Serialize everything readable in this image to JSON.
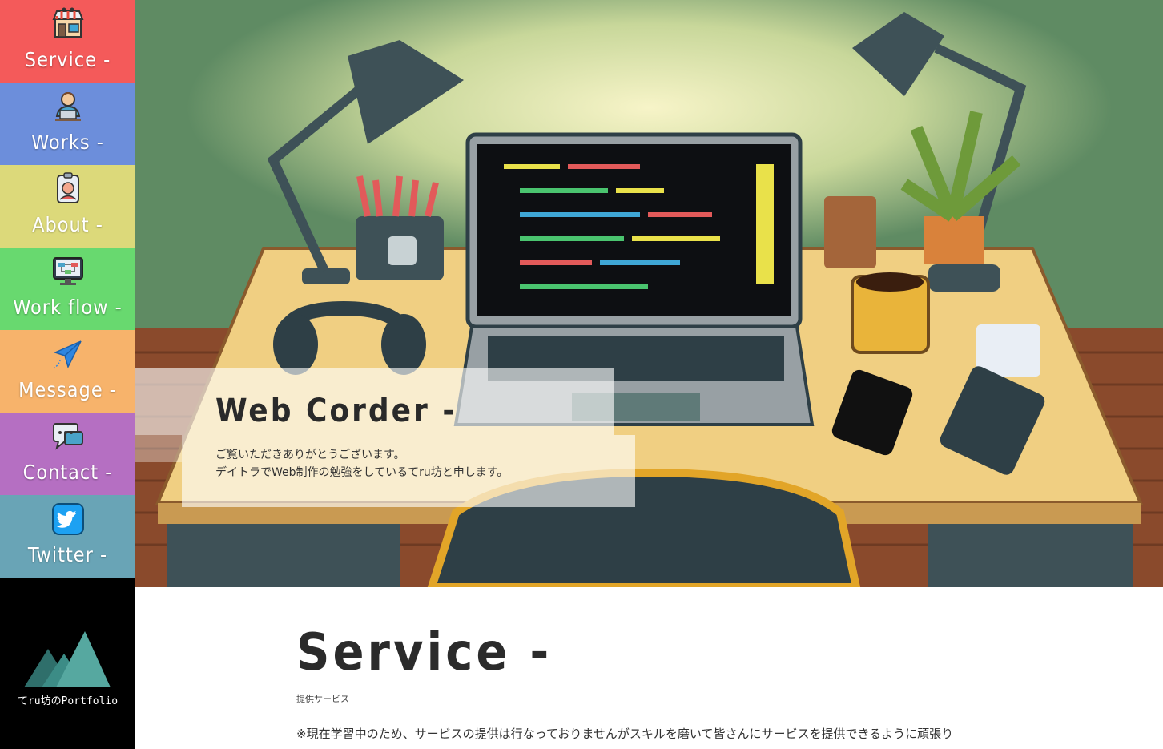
{
  "sidebar": {
    "items": [
      {
        "label": "Service -",
        "icon": "shop-icon",
        "color": "#f45a5a"
      },
      {
        "label": "Works -",
        "icon": "person-at-laptop-icon",
        "color": "#6c8edb"
      },
      {
        "label": "About -",
        "icon": "id-badge-icon",
        "color": "#dcd97a"
      },
      {
        "label": "Work flow -",
        "icon": "flowchart-icon",
        "color": "#68d96f"
      },
      {
        "label": "Message -",
        "icon": "paper-plane-icon",
        "color": "#f7b36b"
      },
      {
        "label": "Contact -",
        "icon": "chat-bubble-icon",
        "color": "#b56fc2"
      },
      {
        "label": "Twitter -",
        "icon": "twitter-bird-icon",
        "color": "#69a4b6"
      }
    ],
    "brand": {
      "text": "てru坊のPortfolio",
      "icon": "mountain-logo-icon"
    }
  },
  "hero": {
    "title": "Web Corder -",
    "lines": [
      "ご覧いただきありがとうございます。",
      "デイトラでWeb制作の勉強をしているてru坊と申します。"
    ],
    "art": "pixel-desk-illustration"
  },
  "service": {
    "title": "Service -",
    "subtitle": "提供サービス",
    "note": "※現在学習中のため、サービスの提供は行なっておりませんがスキルを磨いて皆さんにサービスを提供できるように頑張り"
  }
}
